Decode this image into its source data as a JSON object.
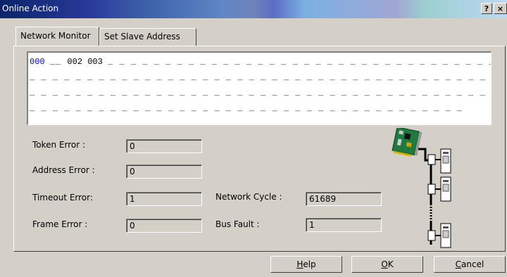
{
  "window": {
    "title": "Online Action",
    "help_glyph": "?",
    "close_glyph": "×"
  },
  "tabs": [
    {
      "label": "Network Monitor",
      "active": true
    },
    {
      "label": "Set Slave Address",
      "active": false
    }
  ],
  "monitor": {
    "lines": [
      {
        "first": "000",
        "rest": "002 003"
      },
      {
        "first": "",
        "rest": ""
      },
      {
        "first": "",
        "rest": ""
      },
      {
        "first": "",
        "rest": ""
      }
    ]
  },
  "stats": {
    "token_error": {
      "label": "Token Error :",
      "value": "0"
    },
    "address_error": {
      "label": "Address Error :",
      "value": "0"
    },
    "timeout_error": {
      "label": "Timeout Error:",
      "value": "1"
    },
    "frame_error": {
      "label": "Frame Error :",
      "value": "0"
    },
    "network_cycle": {
      "label": "Network Cycle :",
      "value": "61689"
    },
    "bus_fault": {
      "label": "Bus Fault :",
      "value": "1"
    }
  },
  "buttons": {
    "help": {
      "label": "Help",
      "hotkey": "H"
    },
    "ok": {
      "label": "OK",
      "hotkey": "O"
    },
    "cancel": {
      "label": "Cancel",
      "hotkey": "C"
    }
  },
  "icon": "network-topology-icon"
}
